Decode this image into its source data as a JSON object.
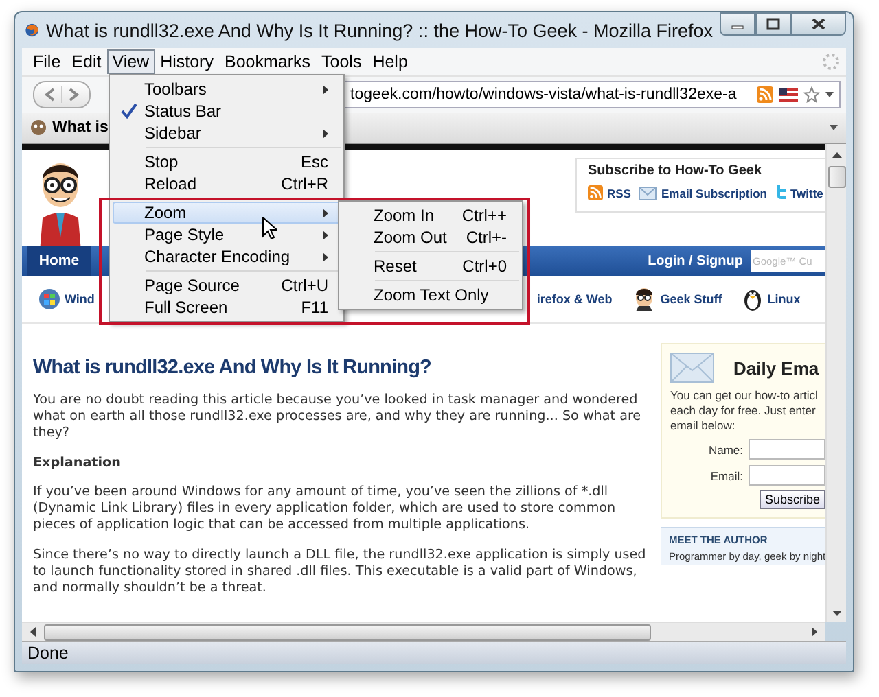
{
  "window": {
    "title": "What is rundll32.exe And Why Is It Running? :: the How-To Geek - Mozilla Firefox"
  },
  "menu_bar": [
    {
      "label": "File",
      "selected": false
    },
    {
      "label": "Edit",
      "selected": false
    },
    {
      "label": "View",
      "selected": true
    },
    {
      "label": "History",
      "selected": false
    },
    {
      "label": "Bookmarks",
      "selected": false
    },
    {
      "label": "Tools",
      "selected": false
    },
    {
      "label": "Help",
      "selected": false
    }
  ],
  "address_bar": {
    "url": "togeek.com/howto/windows-vista/what-is-rundll32exe-a"
  },
  "tab": {
    "title": "What is"
  },
  "view_menu": {
    "items": [
      {
        "kind": "submenu",
        "label": "Toolbars",
        "checked": false,
        "selected": false
      },
      {
        "kind": "command",
        "label": "Status Bar",
        "checked": true,
        "selected": false
      },
      {
        "kind": "submenu",
        "label": "Sidebar",
        "checked": false,
        "selected": false
      },
      {
        "kind": "separator"
      },
      {
        "kind": "command",
        "label": "Stop",
        "shortcut": "Esc",
        "checked": false,
        "selected": false
      },
      {
        "kind": "command",
        "label": "Reload",
        "shortcut": "Ctrl+R",
        "checked": false,
        "selected": false
      },
      {
        "kind": "separator"
      },
      {
        "kind": "submenu",
        "label": "Zoom",
        "checked": false,
        "selected": true
      },
      {
        "kind": "submenu",
        "label": "Page Style",
        "checked": false,
        "selected": false
      },
      {
        "kind": "submenu",
        "label": "Character Encoding",
        "checked": false,
        "selected": false
      },
      {
        "kind": "separator"
      },
      {
        "kind": "command",
        "label": "Page Source",
        "shortcut": "Ctrl+U",
        "checked": false,
        "selected": false
      },
      {
        "kind": "command",
        "label": "Full Screen",
        "shortcut": "F11",
        "checked": false,
        "selected": false
      }
    ]
  },
  "zoom_submenu": {
    "items": [
      {
        "kind": "command",
        "label": "Zoom In",
        "shortcut": "Ctrl++"
      },
      {
        "kind": "command",
        "label": "Zoom Out",
        "shortcut": "Ctrl+-"
      },
      {
        "kind": "separator"
      },
      {
        "kind": "command",
        "label": "Reset",
        "shortcut": "Ctrl+0"
      },
      {
        "kind": "separator"
      },
      {
        "kind": "command",
        "label": "Zoom Text Only"
      }
    ]
  },
  "page": {
    "subscribe": {
      "title": "Subscribe to How-To Geek",
      "links": [
        {
          "kind": "rss",
          "label": "RSS"
        },
        {
          "kind": "email",
          "label": "Email Subscription"
        },
        {
          "kind": "twitter",
          "label": "Twitte"
        }
      ]
    },
    "nav": {
      "home": "Home",
      "login": "Login / Signup",
      "search_placeholder": "Google™ Cu"
    },
    "categories": [
      {
        "kind": "windows",
        "label": "Wind"
      },
      {
        "kind": "plain",
        "label": "irefox & Web"
      },
      {
        "kind": "geek",
        "label": "Geek Stuff"
      },
      {
        "kind": "penguin",
        "label": "Linux"
      }
    ],
    "article": {
      "title": "What is rundll32.exe And Why Is It Running?",
      "blocks": [
        {
          "kind": "text",
          "text": "You are no doubt reading this article because you’ve looked in task manager and wondered what on earth all those rundll32.exe processes are, and why they are running... So what are they?"
        },
        {
          "kind": "heading",
          "text": "Explanation"
        },
        {
          "kind": "text",
          "text": "If you’ve been around Windows for any amount of time, you’ve seen the zillions of *.dll (Dynamic Link Library) files in every application folder, which are used to store common pieces of application logic that can be accessed from multiple applications."
        },
        {
          "kind": "text",
          "text": "Since there’s no way to directly launch a DLL file, the rundll32.exe application is simply used to launch functionality stored in shared .dll files. This executable is a valid part of Windows, and normally shouldn’t be a threat."
        }
      ]
    },
    "daily_email": {
      "title": "Daily Ema",
      "lines": [
        "You can get our how-to articl",
        "each day for free. Just enter",
        "email below:"
      ],
      "fields": [
        {
          "label": "Name:"
        },
        {
          "label": "Email:"
        }
      ],
      "button": "Subscribe"
    },
    "author": {
      "heading": "MEET THE AUTHOR",
      "text": "Programmer by day, geek by night"
    }
  },
  "status_bar": {
    "text": "Done"
  }
}
